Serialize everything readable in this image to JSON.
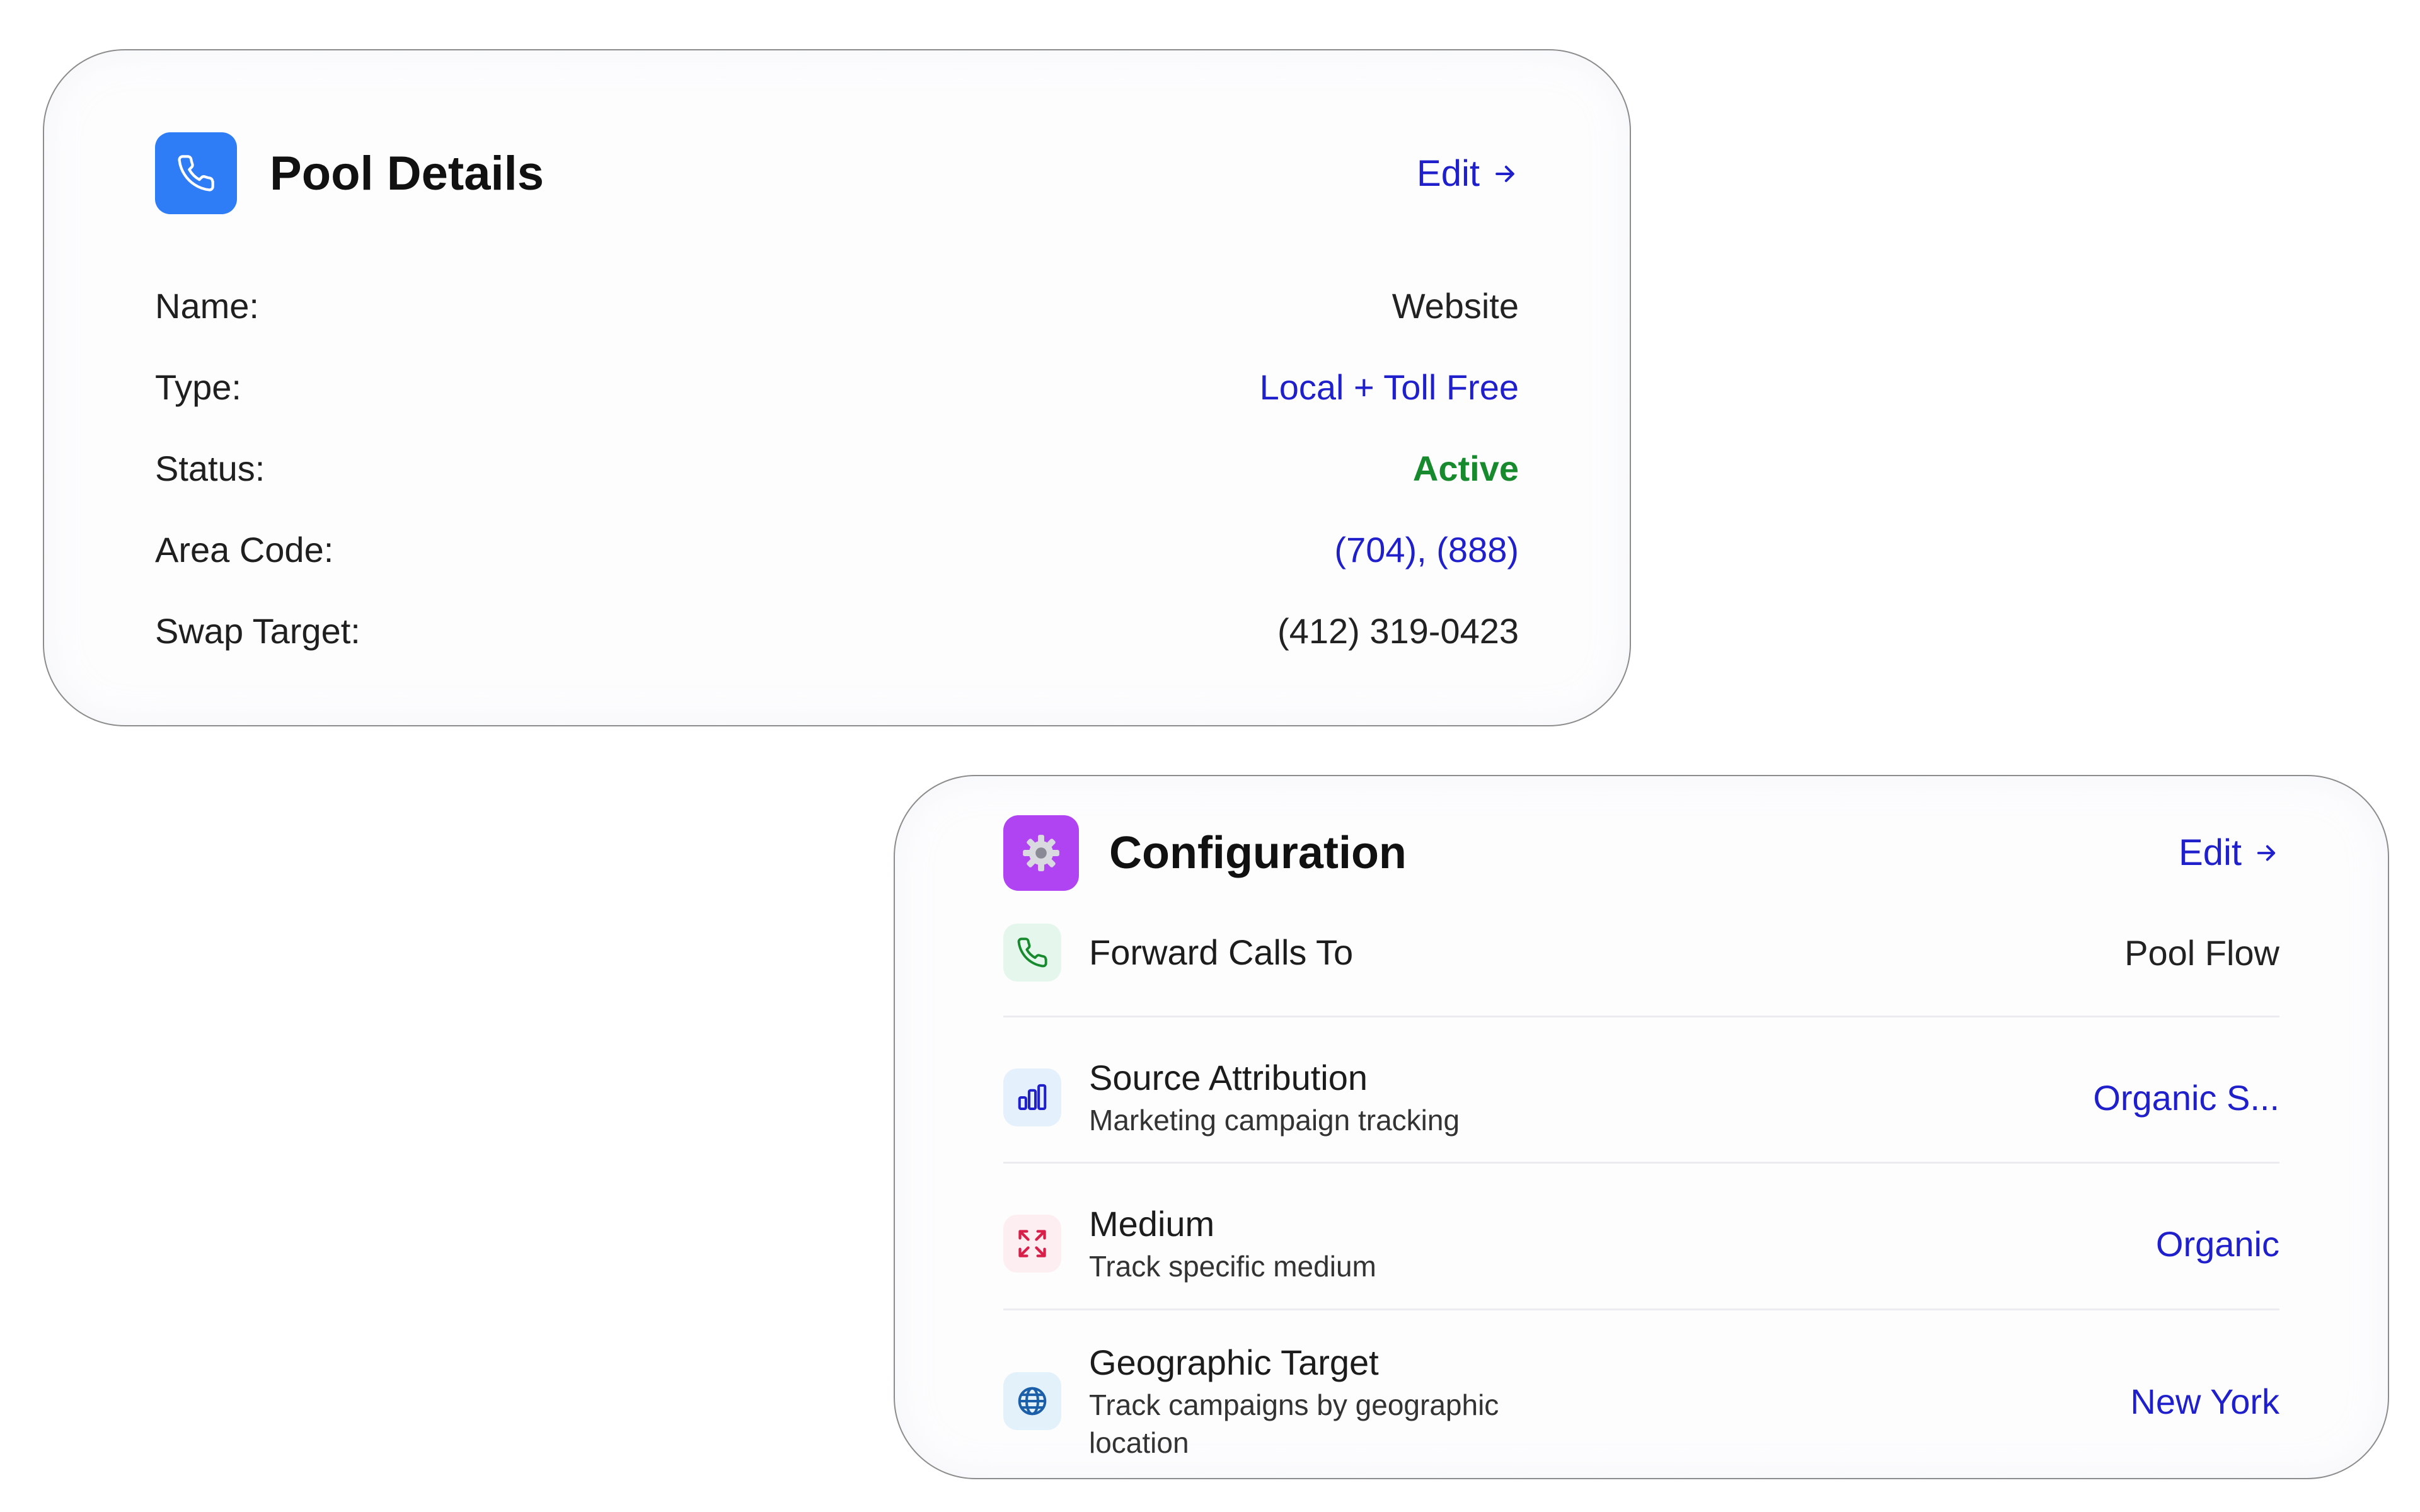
{
  "pool_details": {
    "title": "Pool Details",
    "edit_label": "Edit",
    "icon": "phone-icon",
    "accent_color": "#2f7df6",
    "rows": [
      {
        "label": "Name:",
        "value": "Website"
      },
      {
        "label": "Type:",
        "value": "Local + Toll Free"
      },
      {
        "label": "Status:",
        "value": "Active"
      },
      {
        "label": "Area Code:",
        "value": "(704), (888)"
      },
      {
        "label": "Swap Target:",
        "value": "(412) 319-0423"
      }
    ]
  },
  "configuration": {
    "title": "Configuration",
    "edit_label": "Edit",
    "icon": "gear-icon",
    "accent_color": "#b043f2",
    "items": [
      {
        "title": "Forward Calls To",
        "subtitle": "",
        "value": "Pool Flow",
        "icon": "phone-icon"
      },
      {
        "title": "Source Attribution",
        "subtitle": "Marketing campaign tracking",
        "value": "Organic S...",
        "icon": "bar-chart-icon"
      },
      {
        "title": "Medium",
        "subtitle": "Track specific medium",
        "value": "Organic",
        "icon": "expand-icon"
      },
      {
        "title": "Geographic Target",
        "subtitle": "Track campaigns by geographic location",
        "value": "New York",
        "icon": "globe-icon"
      }
    ]
  },
  "colors": {
    "link_blue": "#1f1fcc",
    "active_green": "#178a2e",
    "border": "#8c8c8c"
  }
}
